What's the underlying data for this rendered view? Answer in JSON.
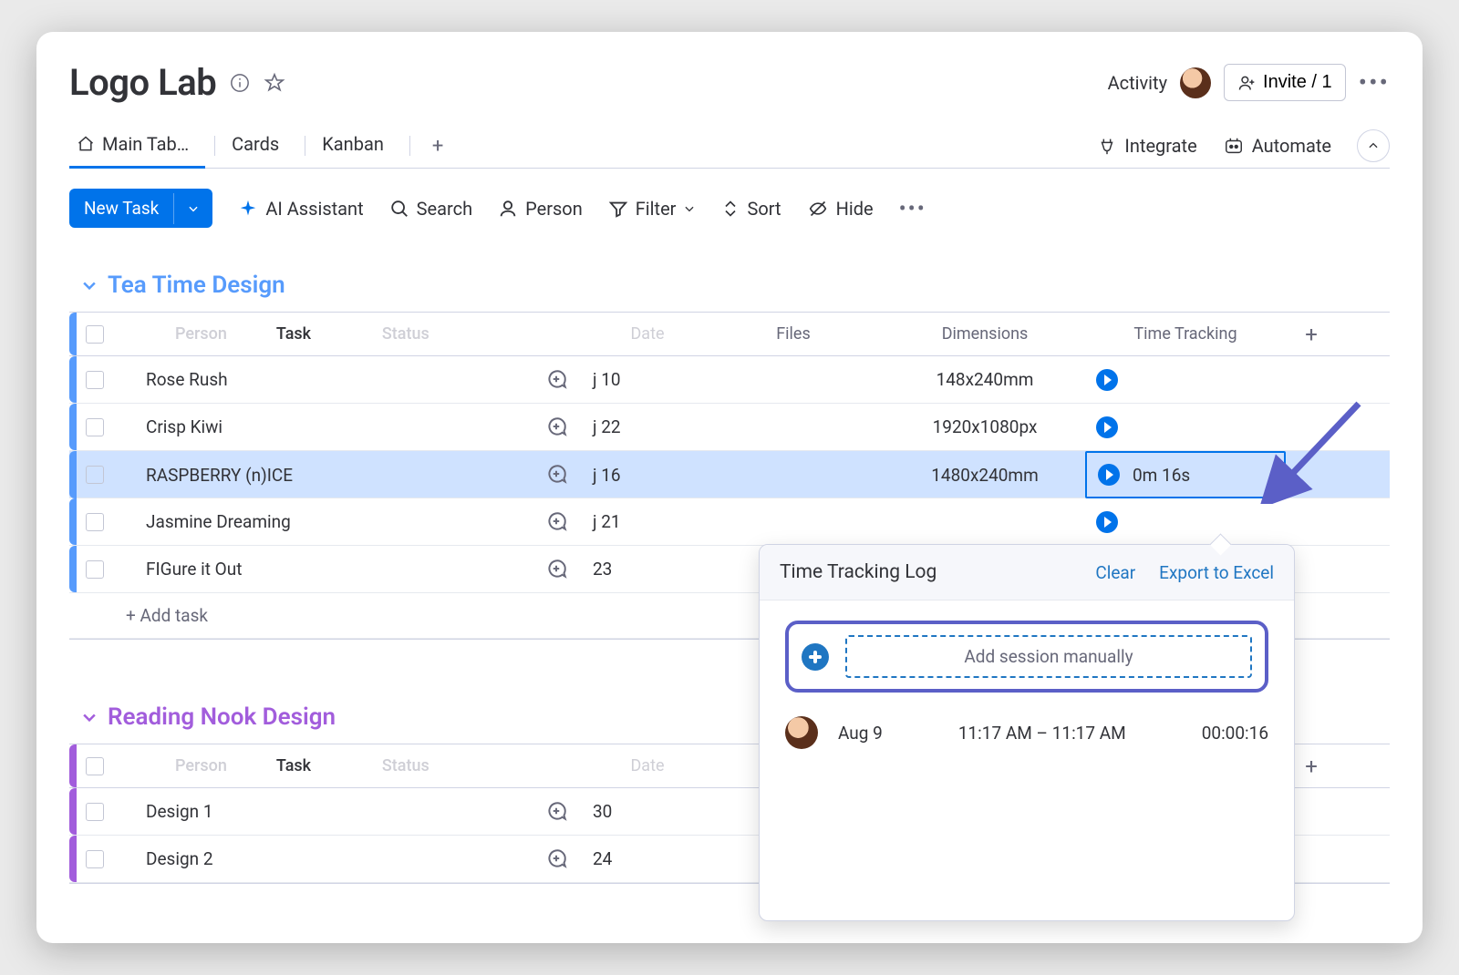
{
  "board": {
    "title": "Logo Lab"
  },
  "topbar": {
    "activity_label": "Activity",
    "invite_label": "Invite / 1"
  },
  "views": {
    "main": "Main Tab…",
    "cards": "Cards",
    "kanban": "Kanban",
    "integrate": "Integrate",
    "automate": "Automate"
  },
  "toolbar": {
    "new_task": "New Task",
    "ai": "AI Assistant",
    "search": "Search",
    "person": "Person",
    "filter": "Filter",
    "sort": "Sort",
    "hide": "Hide"
  },
  "columns": {
    "task": "Task",
    "date": "Date",
    "files": "Files",
    "dimensions": "Dimensions",
    "time_tracking": "Time Tracking",
    "ghost_person": "Person",
    "ghost_status": "Status"
  },
  "groups": [
    {
      "name": "Tea Time Design",
      "color": "blue",
      "rows": [
        {
          "task": "Rose Rush",
          "date": "j 10",
          "file": "",
          "dimensions": "148x240mm",
          "tt": "",
          "selected": false
        },
        {
          "task": "Crisp Kiwi",
          "date": "j 22",
          "file": "green",
          "dimensions": "1920x1080px",
          "tt": "",
          "selected": false
        },
        {
          "task": "RASPBERRY (n)ICE",
          "date": "j 16",
          "file": "pink",
          "dimensions": "1480x240mm",
          "tt": "0m 16s",
          "selected": true
        },
        {
          "task": "Jasmine Dreaming",
          "date": "j 21",
          "file": "",
          "dimensions": "",
          "tt": "",
          "selected": false
        },
        {
          "task": "FIGure it Out",
          "date": "23",
          "file": "",
          "dimensions": "",
          "tt": "",
          "selected": false
        }
      ],
      "add_task": "+ Add task"
    },
    {
      "name": "Reading Nook Design",
      "color": "purple",
      "rows": [
        {
          "task": "Design 1",
          "date": "30",
          "file": "",
          "dimensions": "",
          "tt": "",
          "selected": false
        },
        {
          "task": "Design 2",
          "date": "24",
          "file": "",
          "dimensions": "",
          "tt": "",
          "selected": false
        }
      ]
    }
  ],
  "popover": {
    "title": "Time Tracking Log",
    "clear": "Clear",
    "export": "Export to Excel",
    "add_session": "Add session manually",
    "session": {
      "date": "Aug 9",
      "range": "11:17 AM  –  11:17 AM",
      "duration": "00:00:16"
    }
  }
}
